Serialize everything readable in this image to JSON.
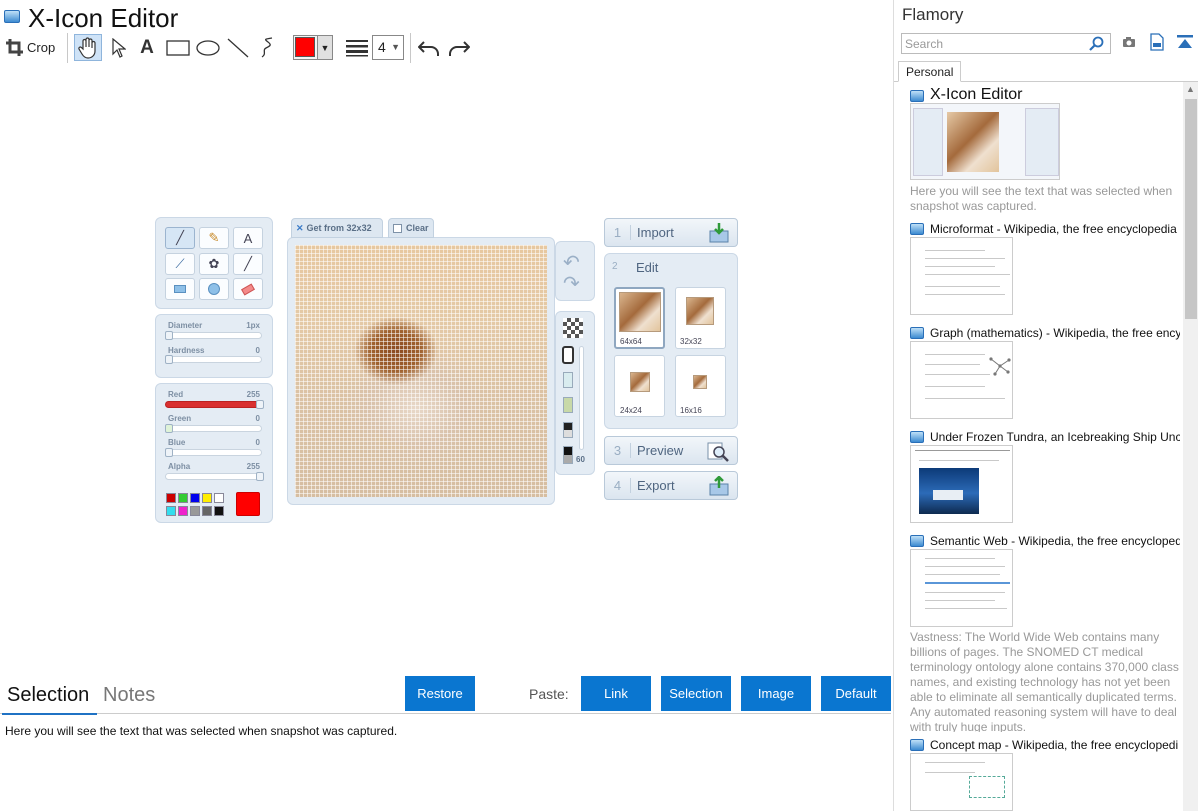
{
  "app": {
    "title": "X-Icon Editor"
  },
  "toolbar": {
    "crop_label": "Crop",
    "stroke_width": "4",
    "current_color": "#ff0000",
    "tools": [
      "hand-icon",
      "select-arrow-icon",
      "text-icon",
      "rectangle-icon",
      "ellipse-icon",
      "line-icon",
      "freehand-icon",
      "undo-icon",
      "redo-icon"
    ]
  },
  "editor": {
    "brush_sliders": [
      {
        "label": "Diameter",
        "value": "1px"
      },
      {
        "label": "Hardness",
        "value": "0"
      }
    ],
    "color_sliders": [
      {
        "label": "Red",
        "value": "255"
      },
      {
        "label": "Green",
        "value": "0"
      },
      {
        "label": "Blue",
        "value": "0"
      },
      {
        "label": "Alpha",
        "value": "255"
      }
    ],
    "palette": [
      "#cc0000",
      "#33cc33",
      "#0000ee",
      "#ffee00",
      "#ffffff",
      "#33ddee",
      "#ee22cc",
      "#999999",
      "#666666",
      "#111111"
    ],
    "canvas_tabs": {
      "get_from": "Get from 32x32",
      "clear": "Clear"
    },
    "opacity_value": "60",
    "steps": [
      {
        "num": "1",
        "label": "Import"
      },
      {
        "num": "2",
        "label": "Edit"
      },
      {
        "num": "3",
        "label": "Preview"
      },
      {
        "num": "4",
        "label": "Export"
      }
    ],
    "sizes": [
      "64x64",
      "32x32",
      "24x24",
      "16x16"
    ]
  },
  "bottom": {
    "tabs": [
      "Selection",
      "Notes"
    ],
    "restore": "Restore",
    "paste_label": "Paste:",
    "paste_buttons": [
      "Link",
      "Selection",
      "Image",
      "Default"
    ],
    "selection_text": "Here you will see the text that was selected when snapshot was captured."
  },
  "sidebar": {
    "title": "Flamory",
    "search_placeholder": "Search",
    "tab": "Personal",
    "items": [
      {
        "title": "X-Icon Editor",
        "note": "Here you will see the text that was selected when snapshot was captured."
      },
      {
        "title": "Microformat - Wikipedia, the free encyclopedia"
      },
      {
        "title": "Graph (mathematics) - Wikipedia, the free ency"
      },
      {
        "title": "Under Frozen Tundra, an Icebreaking Ship Unco"
      },
      {
        "title": "Semantic Web - Wikipedia, the free encycloped",
        "note": "Vastness: The World Wide Web contains many billions of pages. The SNOMED CT medical terminology ontology alone contains 370,000 class names, and existing technology has not yet been able to eliminate all semantically duplicated terms. Any automated reasoning system will have to deal with truly huge inputs."
      },
      {
        "title": "Concept map - Wikipedia, the free encyclopedi"
      }
    ]
  }
}
